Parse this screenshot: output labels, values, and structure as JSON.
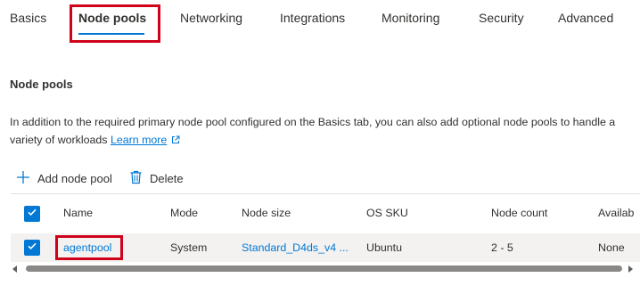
{
  "tabs": [
    {
      "label": "Basics"
    },
    {
      "label": "Node pools"
    },
    {
      "label": "Networking"
    },
    {
      "label": "Integrations"
    },
    {
      "label": "Monitoring"
    },
    {
      "label": "Security"
    },
    {
      "label": "Advanced"
    }
  ],
  "active_tab": "Node pools",
  "section": {
    "title": "Node pools",
    "description": "In addition to the required primary node pool configured on the Basics tab, you can also add optional node pools to handle a variety of workloads",
    "learn_more": "Learn more"
  },
  "toolbar": {
    "add_label": "Add node pool",
    "delete_label": "Delete"
  },
  "table": {
    "columns": [
      "Name",
      "Mode",
      "Node size",
      "OS SKU",
      "Node count",
      "Availab"
    ],
    "rows": [
      {
        "name": "agentpool",
        "mode": "System",
        "node_size": "Standard_D4ds_v4 ...",
        "os_sku": "Ubuntu",
        "node_count": "2 - 5",
        "availability": "None",
        "selected": true
      }
    ]
  },
  "colors": {
    "accent": "#0078d4",
    "highlight": "#d0021b",
    "text": "#323130",
    "row_selected_bg": "#f3f2f1"
  },
  "icons": {
    "add": "plus-icon",
    "delete": "trash-icon",
    "external": "external-link-icon",
    "check": "checkmark-icon"
  }
}
